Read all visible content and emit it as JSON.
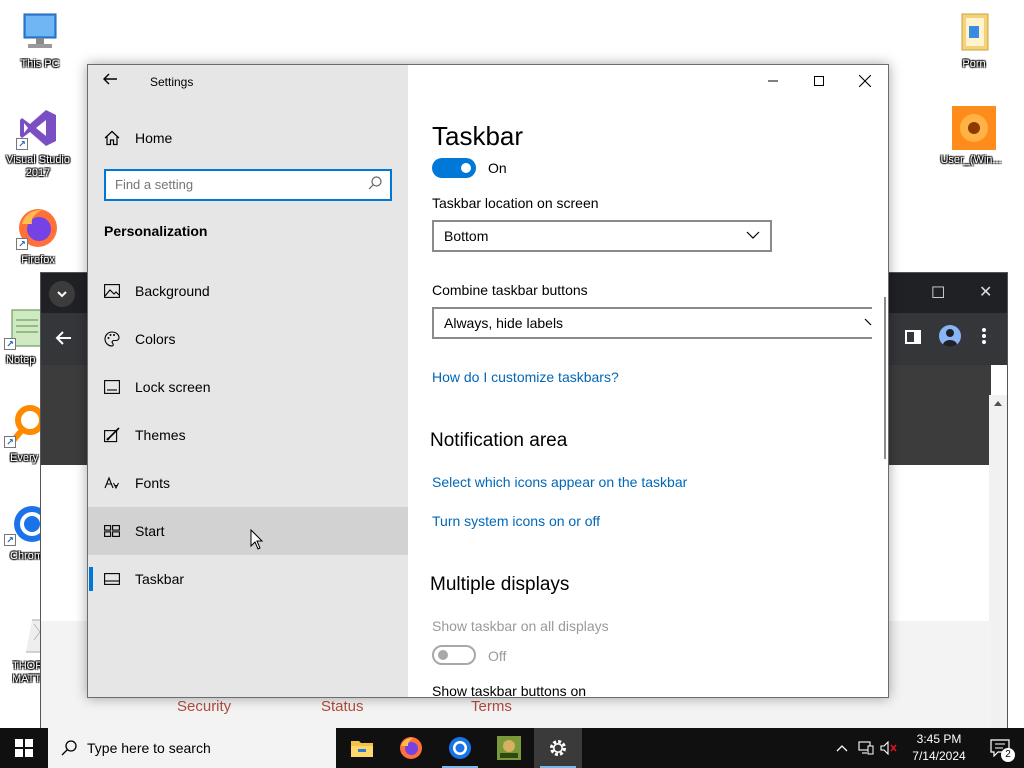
{
  "desktop": {
    "icons": [
      {
        "label": "This PC"
      },
      {
        "label": "Visual Studio 2017"
      },
      {
        "label": "Firefox"
      },
      {
        "label": "Notep"
      },
      {
        "label": "Every"
      },
      {
        "label": "Chrom"
      },
      {
        "label": "THOR MATT"
      },
      {
        "label": "Porn"
      },
      {
        "label": "User_(Win..."
      }
    ]
  },
  "browser_bg": {
    "footer_links": [
      "Security",
      "Status",
      "Terms"
    ]
  },
  "settings": {
    "window_title": "Settings",
    "nav": {
      "home_label": "Home",
      "search_placeholder": "Find a setting",
      "section_label": "Personalization",
      "items": [
        {
          "label": "Background",
          "icon": "picture-icon"
        },
        {
          "label": "Colors",
          "icon": "palette-icon"
        },
        {
          "label": "Lock screen",
          "icon": "lock-screen-icon"
        },
        {
          "label": "Themes",
          "icon": "brush-icon"
        },
        {
          "label": "Fonts",
          "icon": "font-icon"
        },
        {
          "label": "Start",
          "icon": "start-tiles-icon",
          "state": "hover"
        },
        {
          "label": "Taskbar",
          "icon": "taskbar-icon",
          "state": "selected"
        }
      ]
    },
    "content": {
      "page_title": "Taskbar",
      "toggle_top": {
        "state": "On"
      },
      "location_label": "Taskbar location on screen",
      "location_value": "Bottom",
      "combine_label": "Combine taskbar buttons",
      "combine_value": "Always, hide labels",
      "customize_link": "How do I customize taskbars?",
      "notification_heading": "Notification area",
      "link_select_icons": "Select which icons appear on the taskbar",
      "link_system_icons": "Turn system icons on or off",
      "multiple_displays_heading": "Multiple displays",
      "show_all_displays_label": "Show taskbar on all displays",
      "show_all_displays_state": "Off",
      "show_buttons_on_label": "Show taskbar buttons on"
    }
  },
  "taskbar": {
    "search_placeholder": "Type here to search",
    "apps": [
      "file-explorer-icon",
      "firefox-icon",
      "chrome-icon",
      "game-icon",
      "settings-gear-icon"
    ],
    "clock_time": "3:45 PM",
    "clock_date": "7/14/2024",
    "notification_count": "2"
  },
  "colors": {
    "accent": "#0078d7",
    "link": "#0067b8",
    "nav_bg": "#e6e6e6",
    "taskbar_bg": "#101010"
  }
}
